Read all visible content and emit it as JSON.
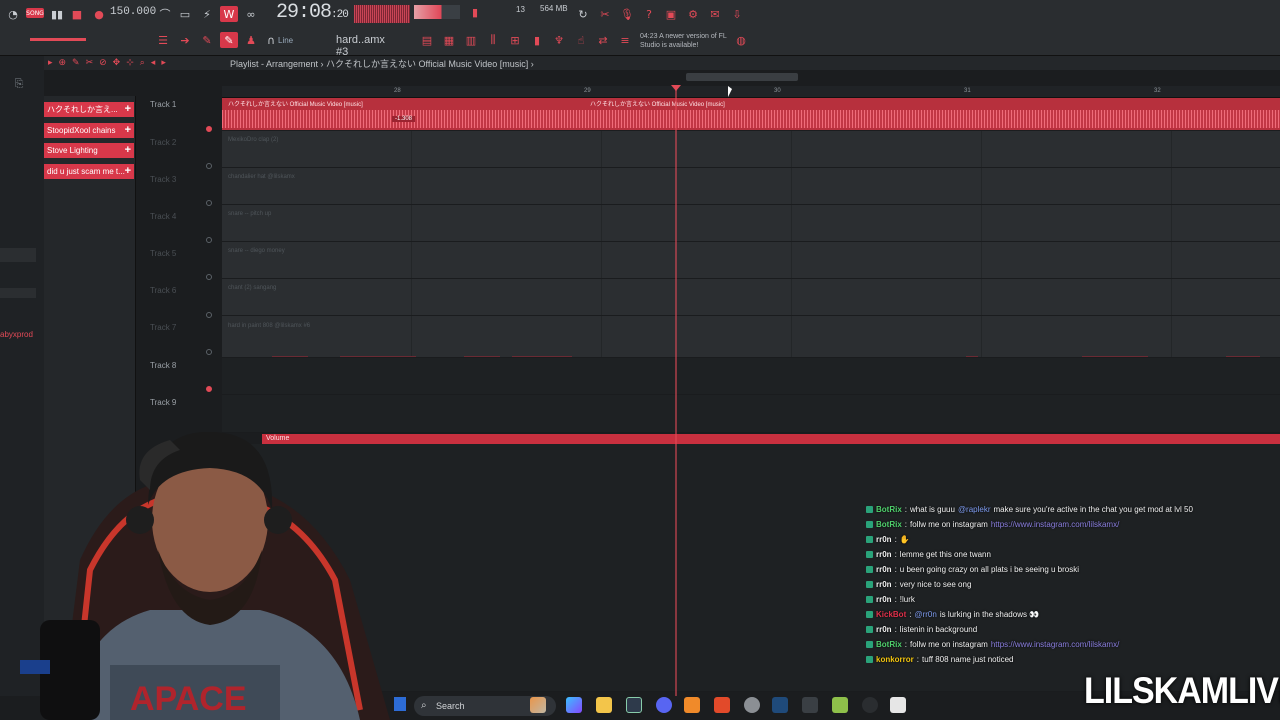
{
  "toolbar": {
    "song_mode": "SONG",
    "tempo": "150.000",
    "time_main": "29:08",
    "time_frac": ":20",
    "cpu_mem": "564 MB",
    "cpu_num": "13",
    "pattern": "hard..amx #3",
    "snap": "Line",
    "update_notice_time": "04:23",
    "update_notice": "A newer version of FL Studio is available!"
  },
  "playlist": {
    "title": "Playlist - Arrangement › ハクそれしか言えない Official Music Video [music] ›",
    "ruler": [
      "28",
      "29",
      "30",
      "31",
      "32"
    ],
    "tracks": [
      {
        "name": "Track 1",
        "clip": "ハクそれしか言えない Official Music Video [music]",
        "clip2": "ハクそれしか言えない Official Music Video [music]",
        "marker": "-1.308"
      },
      {
        "name": "Track 2",
        "clip": "MexikoDro clap (2)"
      },
      {
        "name": "Track 3",
        "clip": "chandalier hat @lilskamx"
      },
      {
        "name": "Track 4",
        "clip": "snare -- pitch up"
      },
      {
        "name": "Track 5",
        "clip": "snare -- diego money"
      },
      {
        "name": "Track 6",
        "clip": "chant (2) sangang"
      },
      {
        "name": "Track 7",
        "clip": "hard in paint 808 @lilskamx #6"
      },
      {
        "name": "Track 8",
        "clip": ""
      },
      {
        "name": "Track 9",
        "clip": ""
      }
    ],
    "automation_label": "Volume"
  },
  "patterns": [
    "ハクそれしか言え...",
    "StoopidXool chains",
    "Stove Lighting",
    "did u just scam me t..."
  ],
  "side_label": "abyxprod",
  "chat": [
    {
      "user": "BotRix",
      "color": "#4fd06c",
      "parts": [
        {
          "t": "what is guuu ",
          "c": ""
        },
        {
          "t": "@raplekr",
          "c": "mention"
        },
        {
          "t": " make sure you're active in the chat you get mod at lvl 50",
          "c": ""
        }
      ]
    },
    {
      "user": "BotRix",
      "color": "#4fd06c",
      "parts": [
        {
          "t": "follw me on instagram ",
          "c": ""
        },
        {
          "t": "https://www.instagram.com/lilskamx/",
          "c": "link"
        }
      ]
    },
    {
      "user": "rr0n",
      "color": "#f1f1f1",
      "parts": [
        {
          "t": "✋",
          "c": ""
        }
      ]
    },
    {
      "user": "rr0n",
      "color": "#f1f1f1",
      "parts": [
        {
          "t": "lemme get this one twann",
          "c": ""
        }
      ]
    },
    {
      "user": "rr0n",
      "color": "#f1f1f1",
      "parts": [
        {
          "t": "u been going crazy on all plats i be seeing u broski",
          "c": ""
        }
      ]
    },
    {
      "user": "rr0n",
      "color": "#f1f1f1",
      "parts": [
        {
          "t": "very nice to see ong",
          "c": ""
        }
      ]
    },
    {
      "user": "rr0n",
      "color": "#f1f1f1",
      "parts": [
        {
          "t": "!lurk",
          "c": ""
        }
      ]
    },
    {
      "user": "KickBot",
      "color": "#e0304a",
      "parts": [
        {
          "t": "@rr0n",
          "c": "mention"
        },
        {
          "t": " is lurking in the shadows 👀",
          "c": ""
        }
      ]
    },
    {
      "user": "rr0n",
      "color": "#f1f1f1",
      "parts": [
        {
          "t": "listenin in background",
          "c": ""
        }
      ]
    },
    {
      "user": "BotRix",
      "color": "#4fd06c",
      "parts": [
        {
          "t": "follw me on instagram ",
          "c": ""
        },
        {
          "t": "https://www.instagram.com/lilskamx/",
          "c": "link"
        }
      ]
    },
    {
      "user": "konkorror",
      "color": "#f1c40f",
      "parts": [
        {
          "t": "tuff 808 name just noticed",
          "c": ""
        }
      ]
    }
  ],
  "taskbar": {
    "search_placeholder": "Search"
  },
  "brand": "LILSKAMLIVE",
  "colors": {
    "accent": "#d8384a",
    "background": "#1b1d1f"
  }
}
